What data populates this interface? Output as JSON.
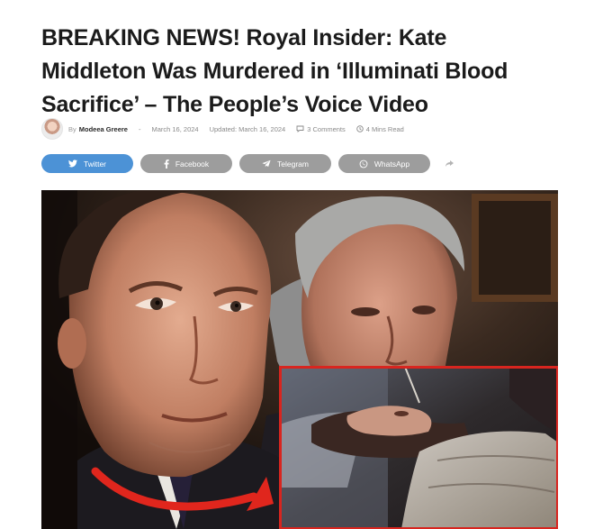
{
  "headline": {
    "line1": "BREAKING NEWS! Royal Insider: Kate",
    "line2": "Middleton Was Murdered in ‘Illuminati Blood",
    "line3": "Sacrifice’ – The People’s Voice Video"
  },
  "meta": {
    "by_label": "By",
    "author": "Modeea Greere",
    "separator": "-",
    "date": "March 16, 2024",
    "updated": "Updated: March 16, 2024",
    "comments": "3 Comments",
    "read_time": "4 Mins Read",
    "icons": {
      "comments": "comment-icon",
      "read_time": "clock-icon"
    }
  },
  "share": {
    "buttons": [
      {
        "label": "Twitter",
        "icon": "twitter-icon",
        "color": "#4c92d6"
      },
      {
        "label": "Facebook",
        "icon": "facebook-icon",
        "color": "#9d9d9d"
      },
      {
        "label": "Telegram",
        "icon": "telegram-icon",
        "color": "#9d9d9d"
      },
      {
        "label": "WhatsApp",
        "icon": "whatsapp-icon",
        "color": "#9d9d9d"
      }
    ],
    "more_icon": "share-arrow-icon"
  },
  "hero_image": {
    "inset_frame_color": "#d8251f",
    "arrow_color": "#e0261d"
  }
}
